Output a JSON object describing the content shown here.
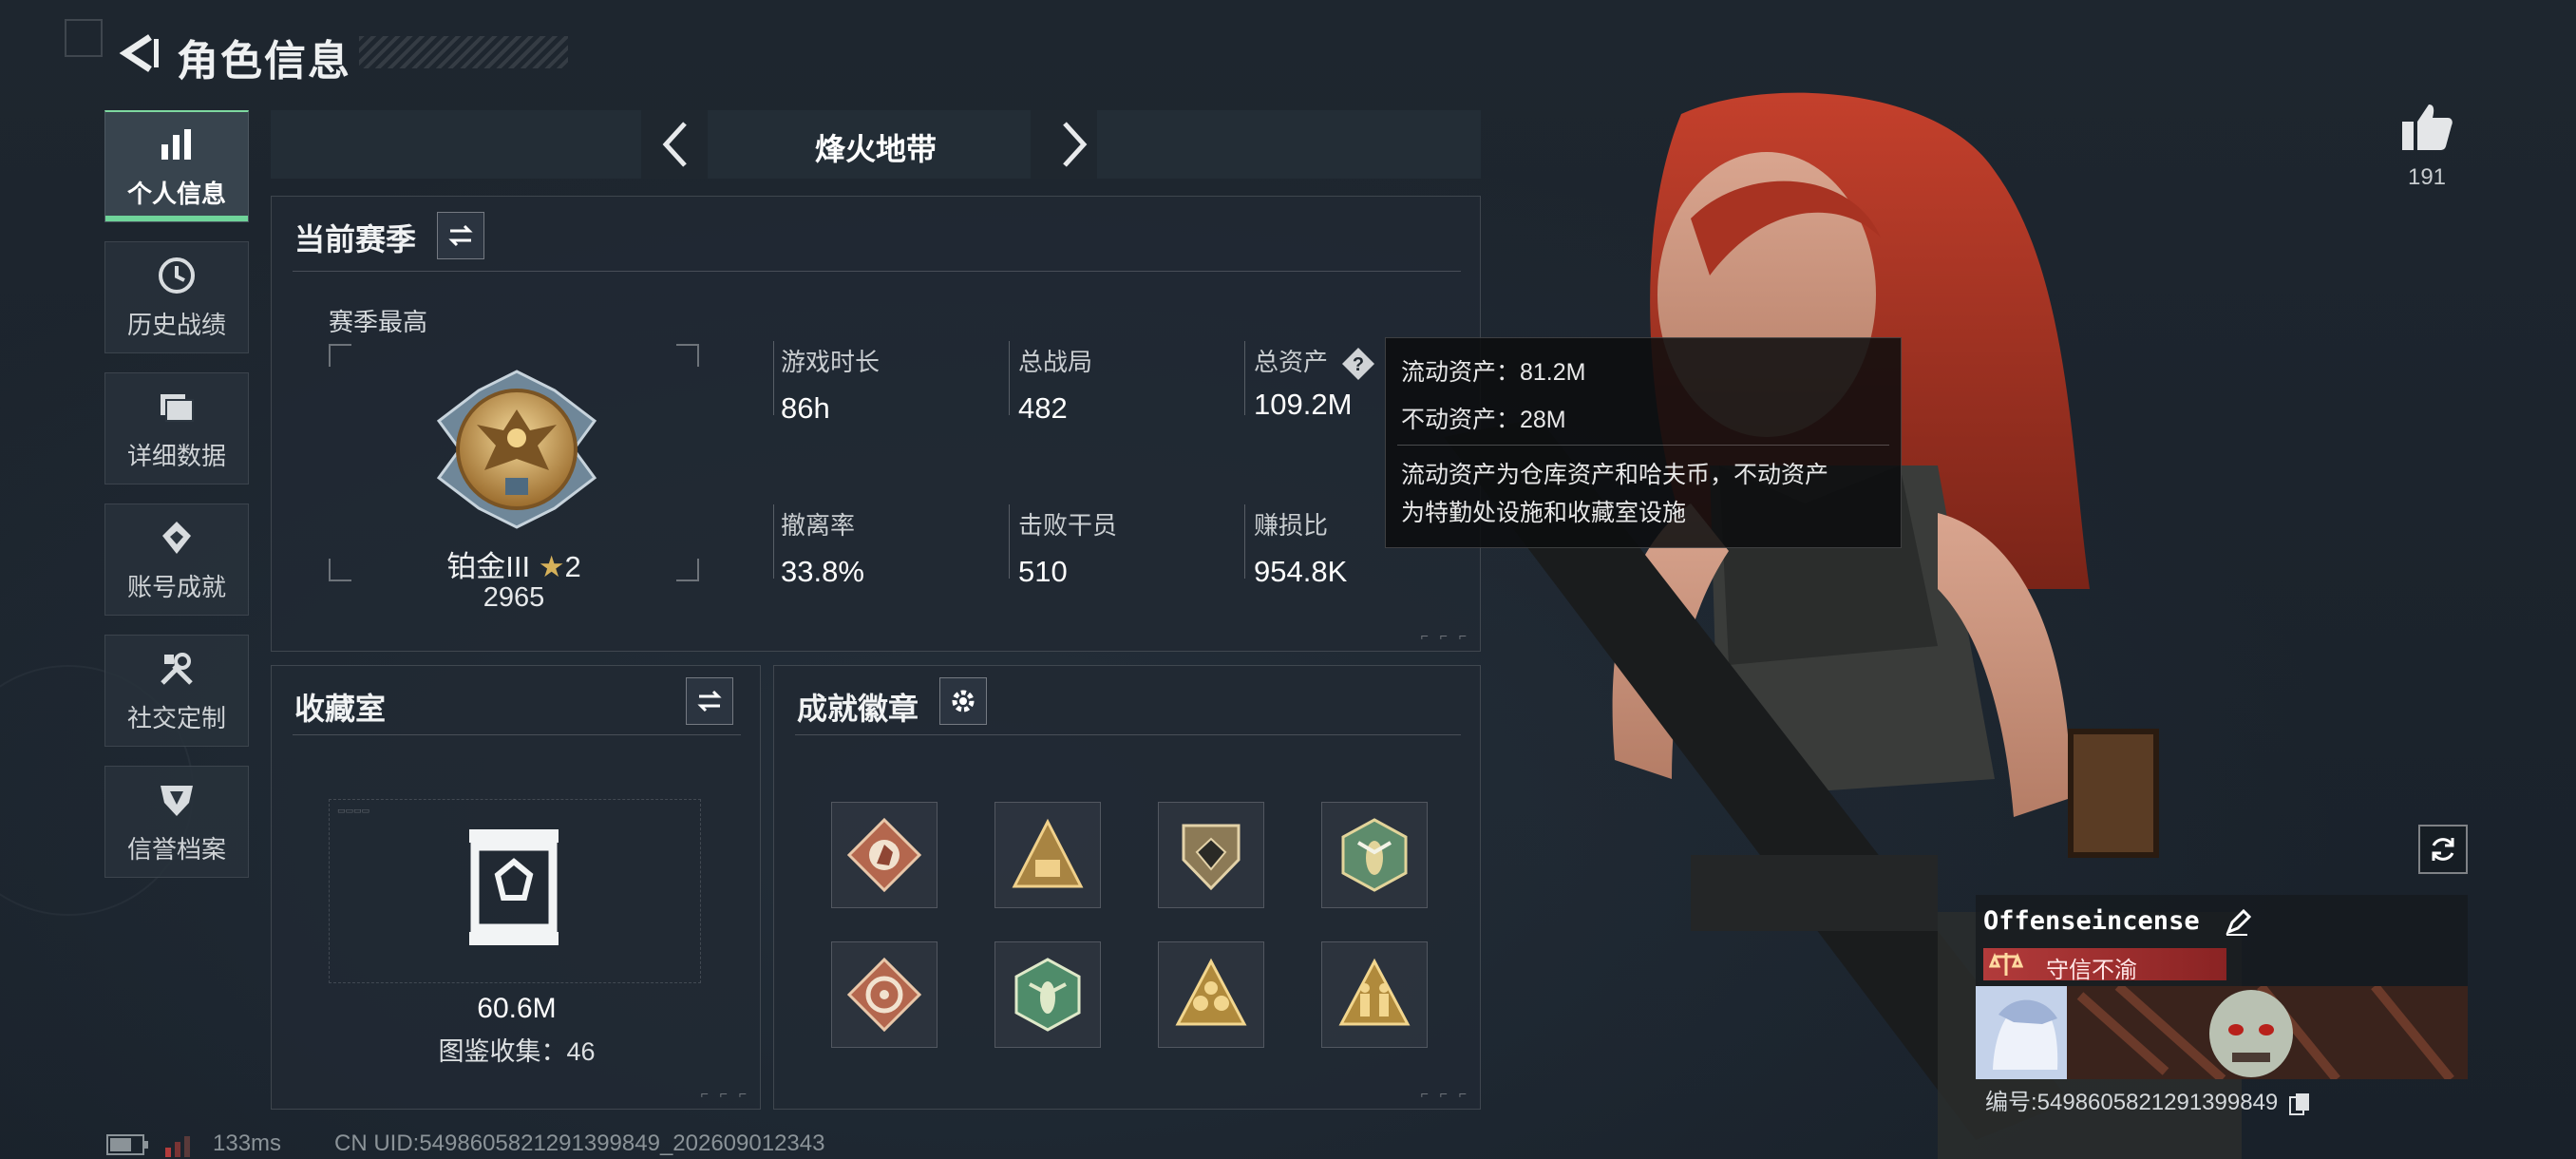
{
  "header": {
    "title": "角色信息"
  },
  "nav": {
    "items": [
      {
        "label": "个人信息",
        "active": true,
        "icon": "bar-chart-icon"
      },
      {
        "label": "历史战绩",
        "active": false,
        "icon": "clock-history-icon"
      },
      {
        "label": "详细数据",
        "active": false,
        "icon": "folder-icon"
      },
      {
        "label": "账号成就",
        "active": false,
        "icon": "achievement-icon"
      },
      {
        "label": "社交定制",
        "active": false,
        "icon": "tools-icon"
      },
      {
        "label": "信誉档案",
        "active": false,
        "icon": "shield-icon"
      }
    ]
  },
  "mode": {
    "label": "烽火地带"
  },
  "season": {
    "title": "当前赛季",
    "best_label": "赛季最高",
    "rank_name": "铂金III",
    "rank_stars": "2",
    "rank_points": "2965",
    "stats": [
      {
        "label": "游戏时长",
        "value": "86h"
      },
      {
        "label": "总战局",
        "value": "482"
      },
      {
        "label": "总资产",
        "value": "109.2M"
      },
      {
        "label": "撤离率",
        "value": "33.8%"
      },
      {
        "label": "击败干员",
        "value": "510"
      },
      {
        "label": "赚损比",
        "value": "954.8K"
      }
    ]
  },
  "tooltip": {
    "liquid": "流动资产：81.2M",
    "fixed": "不动资产：28M",
    "desc_line1": "流动资产为仓库资产和哈夫币，不动资产",
    "desc_line2": "为特勤处设施和收藏室设施"
  },
  "collection": {
    "title": "收藏室",
    "value": "60.6M",
    "count": "图鉴收集：46"
  },
  "badges": {
    "title": "成就徽章",
    "items": [
      {
        "icon": "horse-badge-icon",
        "color": "#b4674e"
      },
      {
        "icon": "pyramid-badge-icon",
        "color": "#a88442"
      },
      {
        "icon": "diamond-badge-icon",
        "color": "#8c7a56"
      },
      {
        "icon": "wasp-badge-icon",
        "color": "#5e8c6c"
      },
      {
        "icon": "wheel-badge-icon",
        "color": "#b4674e"
      },
      {
        "icon": "wasp-green-badge-icon",
        "color": "#4f8c6a"
      },
      {
        "icon": "crown-badge-icon",
        "color": "#b08a3c"
      },
      {
        "icon": "soldiers-badge-icon",
        "color": "#b08a3c"
      }
    ]
  },
  "profile": {
    "likes": "191",
    "name": "Offenseincense",
    "reputation": "守信不渝",
    "id": "编号:5498605821291399849"
  },
  "statusbar": {
    "ping": "133ms",
    "uid": "CN UID:5498605821291399849_202609012343"
  },
  "colors": {
    "accent": "#6fd49a",
    "reputation": "#b23b3b",
    "gold": "#d6b15a"
  }
}
